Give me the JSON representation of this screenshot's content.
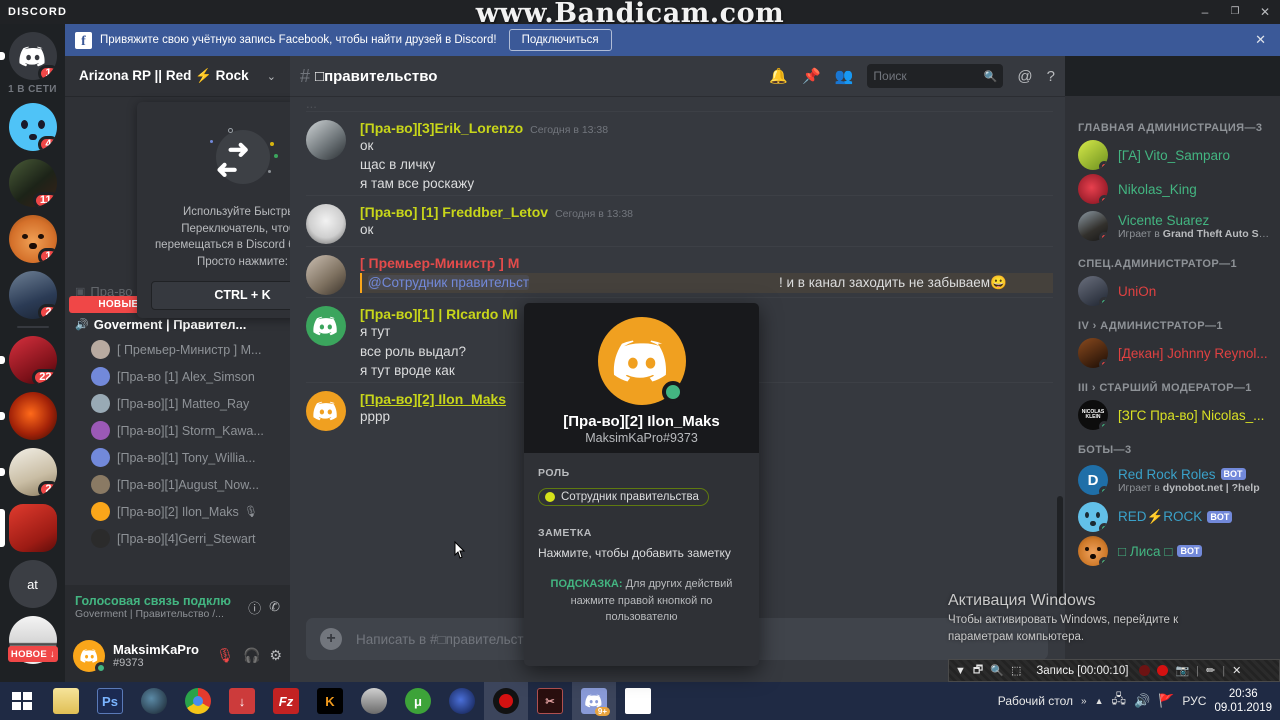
{
  "window": {
    "app_logo": "DISCORD",
    "controls": {
      "minimize": "–",
      "maximize": "❐",
      "close": "✕"
    }
  },
  "watermark": {
    "bandicam": "www.Bandicam.com",
    "windows_activation_title": "Активация Windows",
    "windows_activation_line1": "Чтобы активировать Windows, перейдите к",
    "windows_activation_line2": "параметрам компьютера."
  },
  "promo": {
    "icon": "facebook-icon",
    "text": "Привяжите свою учётную запись Facebook, чтобы найти друзей в Discord!",
    "button": "Подключиться",
    "close": "✕",
    "bg": "#3b5998"
  },
  "rail": {
    "online_label": "1 В СЕТИ",
    "new_label": "НОВОЕ",
    "new_arrow": "↓",
    "servers": [
      {
        "name": "home-discord",
        "badge": "1",
        "color": "#36393f",
        "kind": "discord"
      },
      {
        "name": "server-blue-face",
        "badge": "4",
        "color": "#4fc3f7",
        "kind": "face"
      },
      {
        "name": "server-dark-photo",
        "badge": "11",
        "color": "#273022",
        "kind": "photo-green"
      },
      {
        "name": "server-fox",
        "badge": "1",
        "color": "#e8883a",
        "kind": "fox"
      },
      {
        "name": "server-person-photo",
        "badge": "2",
        "color": "#3a4a63",
        "kind": "photo-blue"
      },
      {
        "name": "server-red-anime",
        "badge": "22",
        "color": "#a41f28",
        "kind": "photo-red"
      },
      {
        "name": "server-red-swirl",
        "badge": "",
        "color": "#8c1d0c",
        "kind": "photo-swirl"
      },
      {
        "name": "server-mlcon",
        "badge": "2",
        "color": "#d8d2c4",
        "kind": "photo-light"
      },
      {
        "name": "server-red-square",
        "badge": "",
        "color": "#c0392b",
        "kind": "square-red"
      },
      {
        "name": "server-at",
        "badge": "",
        "color": "#36393f",
        "kind": "text",
        "label": "at"
      },
      {
        "name": "server-white",
        "badge": "",
        "color": "#e9e9e9",
        "kind": "photo-white"
      }
    ]
  },
  "guild": {
    "name_prefix": "Arizona RP || Red",
    "bolt": "⚡",
    "name_suffix": "Rock",
    "caret": "⌄"
  },
  "quick_switcher": {
    "close": "✕",
    "line1": "Используйте Быстрый",
    "line2": "Переключатель, чтобы",
    "line3": "перемещаться в Discord быстро.",
    "line4": "Просто нажмите:",
    "key": "CTRL + K"
  },
  "sidebar": {
    "hidden_channel": "Пра-во | Общий",
    "mention_bar": {
      "label": "НОВЫЕ УПОМИНАНИЯ",
      "arrow": "↑"
    },
    "active_channel": "Goverment | Правител...",
    "voice_members": [
      {
        "name": "[ Премьер-Министр ] M...",
        "color": "#b8aaa0",
        "muted": false
      },
      {
        "name": "[Пра-во [1] Alex_Simson",
        "color": "#7289da",
        "muted": false
      },
      {
        "name": "[Пра-во][1] Matteo_Ray",
        "color": "#99aab5",
        "muted": false
      },
      {
        "name": "[Пра-во][1] Storm_Kawa...",
        "color": "#9b59b6",
        "muted": false
      },
      {
        "name": "[Пра-во][1] Tony_Willia...",
        "color": "#7289da",
        "muted": false
      },
      {
        "name": "[Пра-во][1]August_Now...",
        "color": "#8a7a64",
        "muted": false
      },
      {
        "name": "[Пра-во][2] Ilon_Maks",
        "color": "#faa61a",
        "muted": true
      },
      {
        "name": "[Пра-во][4]Gerri_Stewart",
        "color": "#2b2b2b",
        "muted": false
      }
    ],
    "voice_panel": {
      "title": "Голосовая связь подклю",
      "subtitle": "Goverment | Правительство /...",
      "info_icon": "ⓘ",
      "disconnect_icon": "✆"
    },
    "user": {
      "name": "MaksimKaPro",
      "tag": "#9373",
      "mic_icon": "mic-muted-icon",
      "headset_icon": "headset-icon",
      "settings_icon": "gear-icon"
    }
  },
  "channel": {
    "hash": "#",
    "lock": "🔒",
    "title": "□правительство",
    "icons": {
      "bell": "🔔",
      "pin": "📌",
      "members": "👥",
      "mention": "@",
      "help": "?"
    },
    "search_placeholder": "Поиск",
    "composer_placeholder": "Написать в #□правительств"
  },
  "messages": [
    {
      "author": "[Пра-во][3]Erik_Lorenzo",
      "color": "#c8d61a",
      "time": "Сегодня в 13:38",
      "avatar_color": "#8f9aa0",
      "lines": [
        "ок",
        "щас в личку",
        "я там все роскажу"
      ]
    },
    {
      "author": "[Пра-во] [1] Freddber_Letov",
      "color": "#c8d61a",
      "time": "Сегодня в 13:38",
      "avatar_color": "#cfcfcf",
      "lines": [
        "ок"
      ]
    },
    {
      "author": "[ Премьер-Министр ] M",
      "color": "#e34b4b",
      "time": "",
      "avatar_color": "#a89a8e",
      "mention_prefix": "@Сотрудник правительст",
      "mention_suffix": "! и в канал заходить не забываем",
      "lines": []
    },
    {
      "author": "[Пра-во][1] | RIcardo MI",
      "color": "#c8d61a",
      "time": "",
      "avatar_color": "#3ba55d",
      "lines": [
        "я тут",
        "все роль выдал?",
        "я тут вроде как"
      ]
    },
    {
      "author": "[Пра-во][2] Ilon_Maks",
      "color": "#c8d61a",
      "time": "",
      "avatar_color": "#f0a020",
      "underline": true,
      "lines": [
        "рррр"
      ]
    }
  ],
  "popout": {
    "name": "[Пра-во][2] Ilon_Maks",
    "tag": "MaksimKaPro#9373",
    "role_label": "РОЛЬ",
    "role_name": "Сотрудник правительства",
    "role_color": "#d6e21a",
    "note_label": "ЗАМЕТКА",
    "note_placeholder": "Нажмите, чтобы добавить заметку",
    "hint_bold": "ПОДСКАЗКА:",
    "hint_rest": " Для других действий",
    "hint_line2": "нажмите правой кнопкой по пользователю",
    "avatar_color": "#f0a020",
    "status_color": "#43b581"
  },
  "member_groups": [
    {
      "title": "ГЛАВНАЯ АДМИНИСТРАЦИЯ—3",
      "members": [
        {
          "name": "[ГА] Vito_Samparo",
          "color": "#43b581",
          "status": "#f04747",
          "avatar": "#b3d334",
          "game": ""
        },
        {
          "name": "Nikolas_King",
          "color": "#43b581",
          "status": "#f04747",
          "avatar": "#a01828",
          "game": ""
        },
        {
          "name": "Vicente Suarez",
          "color": "#43b581",
          "status": "#f04747",
          "avatar": "#3c3c3c",
          "game": "Играет в ",
          "game_bold": "Grand Theft Auto San An..."
        }
      ]
    },
    {
      "title": "СПЕЦ.АДМИНИСТРАТОР—1",
      "members": [
        {
          "name": "UniOn",
          "color": "#e04141",
          "status": "#43b581",
          "avatar": "#2b3340",
          "game": ""
        }
      ]
    },
    {
      "title": "IV › АДМИНИСТРАТОР—1",
      "members": [
        {
          "name": "[Декан] Johnny Reynol...",
          "color": "#e04141",
          "status": "#f04747",
          "avatar": "#23150d",
          "game": ""
        }
      ]
    },
    {
      "title": "III › СТАРШИЙ МОДЕРАТОР—1",
      "members": [
        {
          "name": "[ЗГС Пра-во] Nicolas_...",
          "color": "#d8e024",
          "status": "#43b581",
          "avatar": "#111111",
          "game": ""
        }
      ]
    },
    {
      "title": "БОТЫ—3",
      "members": [
        {
          "name": "Red Rock Roles",
          "color": "#3aa1c9",
          "status": "#43b581",
          "avatar": "#1f6fa8",
          "bot": "BOT",
          "game": "Играет в ",
          "game_bold": "dynobot.net | ?help"
        },
        {
          "name": "RED⚡ROCK",
          "color": "#3aa1c9",
          "status": "#43b581",
          "avatar": "#62c0e8",
          "bot": "BOT",
          "game": ""
        },
        {
          "name": "□ Лиса □",
          "color": "#43b581",
          "status": "#43b581",
          "avatar": "#d98030",
          "bot": "BOT",
          "game": ""
        }
      ]
    }
  ],
  "recorder": {
    "label": "Запись [00:00:10]",
    "icons": [
      "chevron-down-icon",
      "window-icon",
      "zoom-icon",
      "region-icon"
    ],
    "pause_icon": "pause-icon",
    "stop_icon": "stop-icon",
    "camera_icon": "camera-icon",
    "pen_icon": "pen-icon",
    "close_icon": "✕"
  },
  "taskbar": {
    "start": "start-icon",
    "apps": [
      {
        "name": "explorer-icon",
        "color": "#f0d070",
        "label": ""
      },
      {
        "name": "photoshop-icon",
        "color": "#2a3b6b",
        "label": "Ps"
      },
      {
        "name": "steam-icon",
        "color": "#1b2838",
        "label": ""
      },
      {
        "name": "chrome-icon",
        "color": "#ffffff",
        "label": ""
      },
      {
        "name": "download-icon",
        "color": "#d03030",
        "label": "↓"
      },
      {
        "name": "filezilla-icon",
        "color": "#bb2222",
        "label": "Fz"
      },
      {
        "name": "k-lite-icon",
        "color": "#000000",
        "label": "K"
      },
      {
        "name": "gimp-icon",
        "color": "#5a5a5a",
        "label": ""
      },
      {
        "name": "utorrent-icon",
        "color": "#3da339",
        "label": "μ"
      },
      {
        "name": "opera-icon",
        "color": "#1a2a6b",
        "label": ""
      },
      {
        "name": "bandicam-icon",
        "color": "#1a1a1a",
        "label": ""
      },
      {
        "name": "bandicut-icon",
        "color": "#2a1a1a",
        "label": ""
      },
      {
        "name": "discord-icon",
        "color": "#7289da",
        "label": "",
        "badge": "9+"
      },
      {
        "name": "document-icon",
        "color": "#ffffff",
        "label": ""
      }
    ],
    "desktop_label": "Рабочий стол",
    "overflow": "»",
    "up_arrow": "▲",
    "network_icon": "network-icon",
    "volume_icon": "🔊",
    "flag_icon": "flag-icon",
    "lang": "РУС",
    "time": "20:36",
    "date": "09.01.2019"
  }
}
